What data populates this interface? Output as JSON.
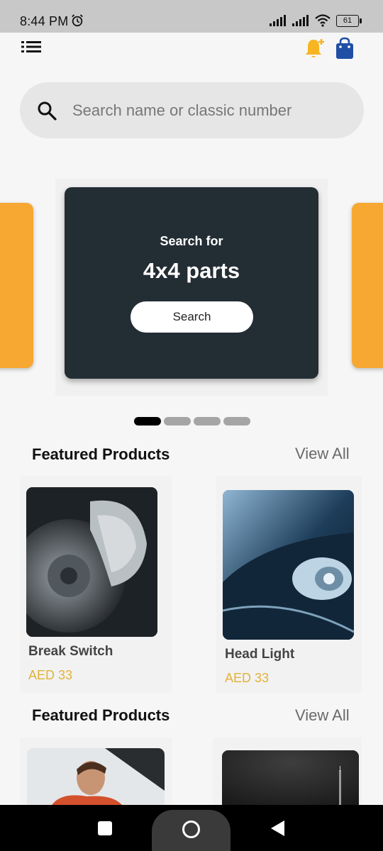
{
  "status_bar": {
    "time": "8:44 PM",
    "battery": "61"
  },
  "search": {
    "placeholder": "Search name or classic number"
  },
  "promo": {
    "subtitle": "Search for",
    "title": "4x4 parts",
    "button_label": "Search"
  },
  "carousel": {
    "page_count": 4,
    "active_index": 0
  },
  "sections": [
    {
      "title": "Featured Products",
      "view_all": "View All",
      "products": [
        {
          "name": "Break Switch",
          "price": "AED 33"
        },
        {
          "name": "Head Light",
          "price": "AED 33"
        }
      ]
    },
    {
      "title": "Featured Products",
      "view_all": "View All"
    }
  ],
  "colors": {
    "accent": "#f7a832",
    "promo_bg": "#232d34",
    "price": "#e2b23a",
    "bag": "#1f4fa5",
    "bell": "#f7b522"
  }
}
